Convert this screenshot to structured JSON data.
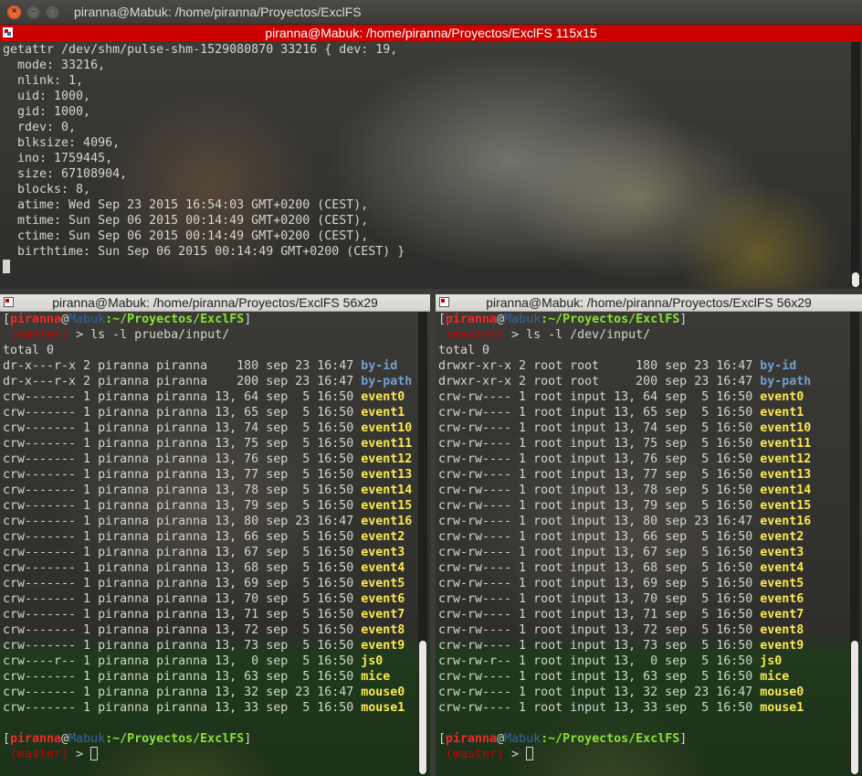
{
  "window": {
    "title": "piranna@Mabuk: /home/piranna/Proyectos/ExclFS",
    "buttons": {
      "close": "×",
      "minimize": "–",
      "maximize": "□"
    }
  },
  "top_pane": {
    "title": "piranna@Mabuk: /home/piranna/Proyectos/ExclFS 115x15",
    "lines": [
      "getattr /dev/shm/pulse-shm-1529080870 33216 { dev: 19,",
      "  mode: 33216,",
      "  nlink: 1,",
      "  uid: 1000,",
      "  gid: 1000,",
      "  rdev: 0,",
      "  blksize: 4096,",
      "  ino: 1759445,",
      "  size: 67108904,",
      "  blocks: 8,",
      "  atime: Wed Sep 23 2015 16:54:03 GMT+0200 (CEST),",
      "  mtime: Sun Sep 06 2015 00:14:49 GMT+0200 (CEST),",
      "  ctime: Sun Sep 06 2015 00:14:49 GMT+0200 (CEST),",
      "  birthtime: Sun Sep 06 2015 00:14:49 GMT+0200 (CEST) }"
    ]
  },
  "left_pane": {
    "title": "piranna@Mabuk: /home/piranna/Proyectos/ExclFS 56x29",
    "prompt": {
      "user": "piranna",
      "at": "@",
      "host": "Mabuk",
      "path": ":~/Proyectos/ExclFS",
      "branch": " (master)",
      "arrow": " > "
    },
    "command": "ls -l prueba/input/",
    "total": "total 0",
    "entries": [
      {
        "meta": "dr-x---r-x 2 piranna piranna    180 sep 23 16:47 ",
        "name": "by-id",
        "kind": "dir"
      },
      {
        "meta": "dr-x---r-x 2 piranna piranna    200 sep 23 16:47 ",
        "name": "by-path",
        "kind": "dir"
      },
      {
        "meta": "crw------- 1 piranna piranna 13, 64 sep  5 16:50 ",
        "name": "event0",
        "kind": "dev"
      },
      {
        "meta": "crw------- 1 piranna piranna 13, 65 sep  5 16:50 ",
        "name": "event1",
        "kind": "dev"
      },
      {
        "meta": "crw------- 1 piranna piranna 13, 74 sep  5 16:50 ",
        "name": "event10",
        "kind": "dev"
      },
      {
        "meta": "crw------- 1 piranna piranna 13, 75 sep  5 16:50 ",
        "name": "event11",
        "kind": "dev"
      },
      {
        "meta": "crw------- 1 piranna piranna 13, 76 sep  5 16:50 ",
        "name": "event12",
        "kind": "dev"
      },
      {
        "meta": "crw------- 1 piranna piranna 13, 77 sep  5 16:50 ",
        "name": "event13",
        "kind": "dev"
      },
      {
        "meta": "crw------- 1 piranna piranna 13, 78 sep  5 16:50 ",
        "name": "event14",
        "kind": "dev"
      },
      {
        "meta": "crw------- 1 piranna piranna 13, 79 sep  5 16:50 ",
        "name": "event15",
        "kind": "dev"
      },
      {
        "meta": "crw------- 1 piranna piranna 13, 80 sep 23 16:47 ",
        "name": "event16",
        "kind": "dev"
      },
      {
        "meta": "crw------- 1 piranna piranna 13, 66 sep  5 16:50 ",
        "name": "event2",
        "kind": "dev"
      },
      {
        "meta": "crw------- 1 piranna piranna 13, 67 sep  5 16:50 ",
        "name": "event3",
        "kind": "dev"
      },
      {
        "meta": "crw------- 1 piranna piranna 13, 68 sep  5 16:50 ",
        "name": "event4",
        "kind": "dev"
      },
      {
        "meta": "crw------- 1 piranna piranna 13, 69 sep  5 16:50 ",
        "name": "event5",
        "kind": "dev"
      },
      {
        "meta": "crw------- 1 piranna piranna 13, 70 sep  5 16:50 ",
        "name": "event6",
        "kind": "dev"
      },
      {
        "meta": "crw------- 1 piranna piranna 13, 71 sep  5 16:50 ",
        "name": "event7",
        "kind": "dev"
      },
      {
        "meta": "crw------- 1 piranna piranna 13, 72 sep  5 16:50 ",
        "name": "event8",
        "kind": "dev"
      },
      {
        "meta": "crw------- 1 piranna piranna 13, 73 sep  5 16:50 ",
        "name": "event9",
        "kind": "dev"
      },
      {
        "meta": "crw----r-- 1 piranna piranna 13,  0 sep  5 16:50 ",
        "name": "js0",
        "kind": "dev"
      },
      {
        "meta": "crw------- 1 piranna piranna 13, 63 sep  5 16:50 ",
        "name": "mice",
        "kind": "dev"
      },
      {
        "meta": "crw------- 1 piranna piranna 13, 32 sep 23 16:47 ",
        "name": "mouse0",
        "kind": "dev"
      },
      {
        "meta": "crw------- 1 piranna piranna 13, 33 sep  5 16:50 ",
        "name": "mouse1",
        "kind": "dev"
      }
    ]
  },
  "right_pane": {
    "title": "piranna@Mabuk: /home/piranna/Proyectos/ExclFS 56x29",
    "prompt": {
      "user": "piranna",
      "at": "@",
      "host": "Mabuk",
      "path": ":~/Proyectos/ExclFS",
      "branch": " (master)",
      "arrow": " > "
    },
    "command": "ls -l /dev/input/",
    "total": "total 0",
    "entries": [
      {
        "meta": "drwxr-xr-x 2 root root     180 sep 23 16:47 ",
        "name": "by-id",
        "kind": "dir"
      },
      {
        "meta": "drwxr-xr-x 2 root root     200 sep 23 16:47 ",
        "name": "by-path",
        "kind": "dir"
      },
      {
        "meta": "crw-rw---- 1 root input 13, 64 sep  5 16:50 ",
        "name": "event0",
        "kind": "dev"
      },
      {
        "meta": "crw-rw---- 1 root input 13, 65 sep  5 16:50 ",
        "name": "event1",
        "kind": "dev"
      },
      {
        "meta": "crw-rw---- 1 root input 13, 74 sep  5 16:50 ",
        "name": "event10",
        "kind": "dev"
      },
      {
        "meta": "crw-rw---- 1 root input 13, 75 sep  5 16:50 ",
        "name": "event11",
        "kind": "dev"
      },
      {
        "meta": "crw-rw---- 1 root input 13, 76 sep  5 16:50 ",
        "name": "event12",
        "kind": "dev"
      },
      {
        "meta": "crw-rw---- 1 root input 13, 77 sep  5 16:50 ",
        "name": "event13",
        "kind": "dev"
      },
      {
        "meta": "crw-rw---- 1 root input 13, 78 sep  5 16:50 ",
        "name": "event14",
        "kind": "dev"
      },
      {
        "meta": "crw-rw---- 1 root input 13, 79 sep  5 16:50 ",
        "name": "event15",
        "kind": "dev"
      },
      {
        "meta": "crw-rw---- 1 root input 13, 80 sep 23 16:47 ",
        "name": "event16",
        "kind": "dev"
      },
      {
        "meta": "crw-rw---- 1 root input 13, 66 sep  5 16:50 ",
        "name": "event2",
        "kind": "dev"
      },
      {
        "meta": "crw-rw---- 1 root input 13, 67 sep  5 16:50 ",
        "name": "event3",
        "kind": "dev"
      },
      {
        "meta": "crw-rw---- 1 root input 13, 68 sep  5 16:50 ",
        "name": "event4",
        "kind": "dev"
      },
      {
        "meta": "crw-rw---- 1 root input 13, 69 sep  5 16:50 ",
        "name": "event5",
        "kind": "dev"
      },
      {
        "meta": "crw-rw---- 1 root input 13, 70 sep  5 16:50 ",
        "name": "event6",
        "kind": "dev"
      },
      {
        "meta": "crw-rw---- 1 root input 13, 71 sep  5 16:50 ",
        "name": "event7",
        "kind": "dev"
      },
      {
        "meta": "crw-rw---- 1 root input 13, 72 sep  5 16:50 ",
        "name": "event8",
        "kind": "dev"
      },
      {
        "meta": "crw-rw---- 1 root input 13, 73 sep  5 16:50 ",
        "name": "event9",
        "kind": "dev"
      },
      {
        "meta": "crw-rw-r-- 1 root input 13,  0 sep  5 16:50 ",
        "name": "js0",
        "kind": "dev"
      },
      {
        "meta": "crw-rw---- 1 root input 13, 63 sep  5 16:50 ",
        "name": "mice",
        "kind": "dev"
      },
      {
        "meta": "crw-rw---- 1 root input 13, 32 sep 23 16:47 ",
        "name": "mouse0",
        "kind": "dev"
      },
      {
        "meta": "crw-rw---- 1 root input 13, 33 sep  5 16:50 ",
        "name": "mouse1",
        "kind": "dev"
      }
    ]
  },
  "colors": {
    "prompt_user": "#ef2929",
    "prompt_host": "#3465a4",
    "prompt_path": "#8ae234",
    "directory": "#729fcf",
    "device": "#fce94f",
    "active_title": "#cc0000"
  }
}
